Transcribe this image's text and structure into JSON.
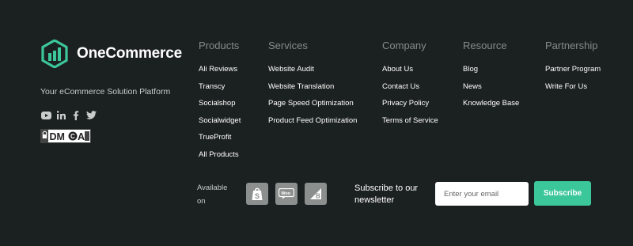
{
  "brand": {
    "name": "OneCommerce",
    "tagline": "Your eCommerce Solution Platform",
    "accent_color": "#3cc79a"
  },
  "social": [
    "youtube-icon",
    "linkedin-icon",
    "facebook-icon",
    "twitter-icon"
  ],
  "dmca_badge": "DMCA",
  "columns": [
    {
      "heading": "Products",
      "items": [
        "Ali Reviews",
        "Transcy",
        "Socialshop",
        "Socialwidget",
        "TrueProfit",
        "All Products"
      ]
    },
    {
      "heading": "Services",
      "items": [
        "Website Audit",
        "Website Translation",
        "Page Speed Optimization",
        "Product Feed Optimization"
      ]
    },
    {
      "heading": "Company",
      "items": [
        "About Us",
        "Contact Us",
        "Privacy Policy",
        "Terms of Service"
      ]
    },
    {
      "heading": "Resource",
      "items": [
        "Blog",
        "News",
        "Knowledge Base"
      ]
    },
    {
      "heading": "Partnership",
      "items": [
        "Partner Program",
        "Write For Us"
      ]
    }
  ],
  "available_on": {
    "label": "Available on",
    "platforms": [
      "shopify-icon",
      "woocommerce-icon",
      "bigcommerce-icon"
    ]
  },
  "subscribe": {
    "text": "Subscribe to our newsletter",
    "placeholder": "Enter your email",
    "button": "Subscribe"
  }
}
